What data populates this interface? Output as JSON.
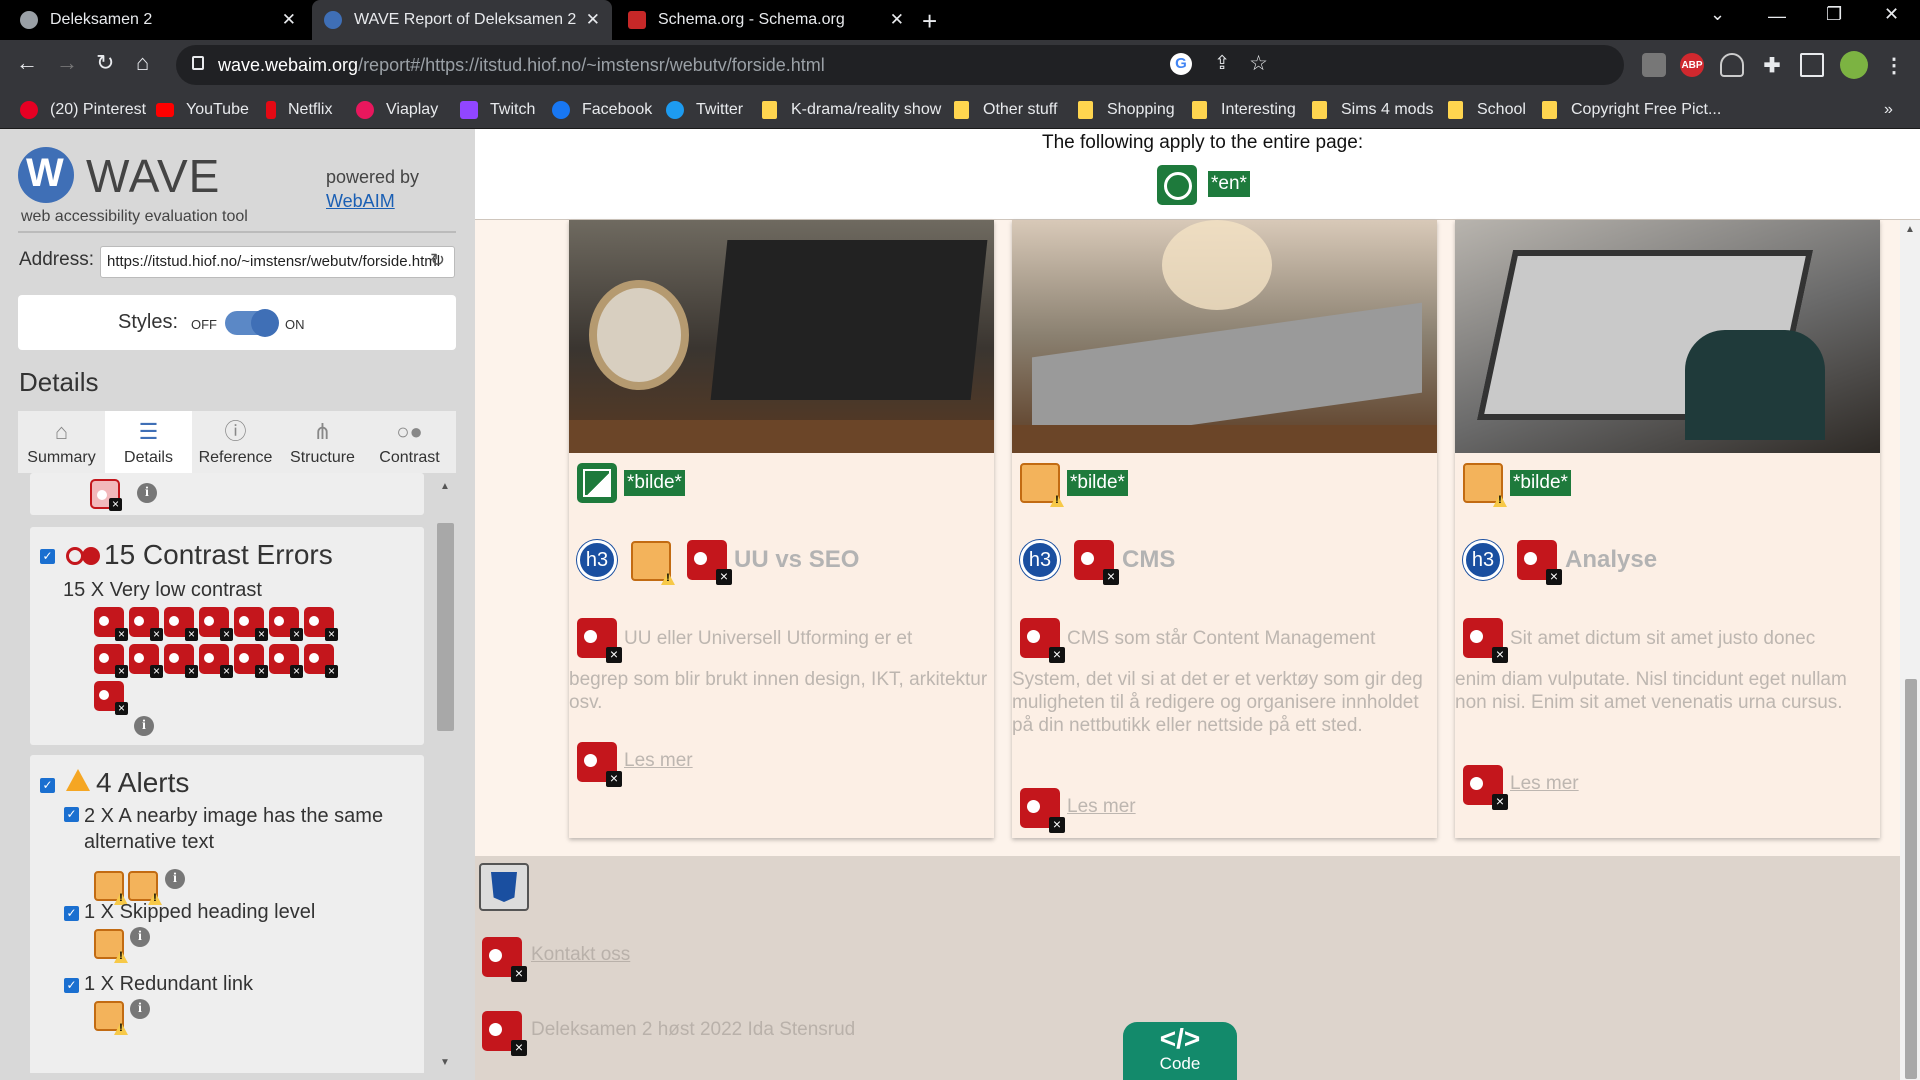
{
  "browser": {
    "tabs": [
      {
        "title": "Deleksamen 2",
        "active": false
      },
      {
        "title": "WAVE Report of Deleksamen 2",
        "active": true
      },
      {
        "title": "Schema.org - Schema.org",
        "active": false
      }
    ],
    "url_host": "wave.webaim.org",
    "url_path": "/report#/https://itstud.hiof.no/~imstensr/webutv/forside.html",
    "extensions": [
      "ABP"
    ],
    "bookmarks": [
      {
        "label": "(20) Pinterest",
        "icon": "pinterest-icon",
        "color": "#e60023"
      },
      {
        "label": "YouTube",
        "icon": "youtube-icon",
        "color": "#ff0000"
      },
      {
        "label": "Netflix",
        "icon": "netflix-icon",
        "color": "#e50914"
      },
      {
        "label": "Viaplay",
        "icon": "viaplay-icon",
        "color": "#e8175d"
      },
      {
        "label": "Twitch",
        "icon": "twitch-icon",
        "color": "#9146ff"
      },
      {
        "label": "Facebook",
        "icon": "facebook-icon",
        "color": "#1877f2"
      },
      {
        "label": "Twitter",
        "icon": "twitter-icon",
        "color": "#1d9bf0"
      },
      {
        "label": "K-drama/reality show",
        "icon": "folder-icon"
      },
      {
        "label": "Other stuff",
        "icon": "folder-icon"
      },
      {
        "label": "Shopping",
        "icon": "folder-icon"
      },
      {
        "label": "Interesting",
        "icon": "folder-icon"
      },
      {
        "label": "Sims 4 mods",
        "icon": "folder-icon"
      },
      {
        "label": "School",
        "icon": "folder-icon"
      },
      {
        "label": "Copyright Free Pict...",
        "icon": "folder-icon"
      }
    ],
    "more_bookmarks": "»"
  },
  "wave": {
    "logo_text": "WAVE",
    "logo_mark": "W",
    "tagline": "web accessibility evaluation tool",
    "powered_by": "powered by",
    "webaim": "WebAIM",
    "address_label": "Address:",
    "address_value": "https://itstud.hiof.no/~imstensr/webutv/forside.html",
    "styles_label": "Styles:",
    "styles_off": "OFF",
    "styles_on": "ON",
    "styles_state": "on",
    "details_heading": "Details",
    "tabs": [
      "Summary",
      "Details",
      "Reference",
      "Structure",
      "Contrast"
    ],
    "active_tab": "Details",
    "contrast_group": {
      "title": "15 Contrast Errors",
      "line": "15 X Very low contrast",
      "count": 15
    },
    "alerts_group": {
      "title": "4 Alerts",
      "items": [
        {
          "label": "2 X A nearby image has the same alternative text",
          "icons": 2
        },
        {
          "label": "1 X Skipped heading level",
          "icons": 1
        },
        {
          "label": "1 X Redundant link",
          "icons": 1
        }
      ]
    }
  },
  "page": {
    "entire_page_text": "The following apply to the entire page:",
    "lang_tag": "*en*",
    "cards": [
      {
        "bilde": "*bilde*",
        "title": "UU vs SEO",
        "text_first": "UU eller Universell Utforming er et",
        "text_rest": "begrep som blir brukt innen design, IKT, arkitektur osv.",
        "link": "Les mer",
        "image_icon": "green",
        "has_heading_alert": true
      },
      {
        "bilde": "*bilde*",
        "title": "CMS",
        "text_first": "CMS som står Content Management",
        "text_rest": "System, det vil si at det er et verktøy som gir deg muligheten til å redigere og organisere innholdet på din nettbutikk eller nettside på ett sted.",
        "link": "Les mer",
        "image_icon": "alert",
        "has_heading_alert": false
      },
      {
        "bilde": "*bilde*",
        "title": "Analyse",
        "text_first": "Sit amet dictum sit amet justo donec",
        "text_rest": "enim diam vulputate. Nisl tincidunt eget nullam non nisi. Enim sit amet venenatis urna cursus.",
        "link": "Les mer",
        "image_icon": "alert",
        "has_heading_alert": false
      }
    ],
    "h3_label": "h3",
    "footer_link": "Kontakt oss",
    "footer_copyright": "Deleksamen 2 høst 2022 Ida Stensrud",
    "code_icon": "</>",
    "code_label": "Code"
  }
}
